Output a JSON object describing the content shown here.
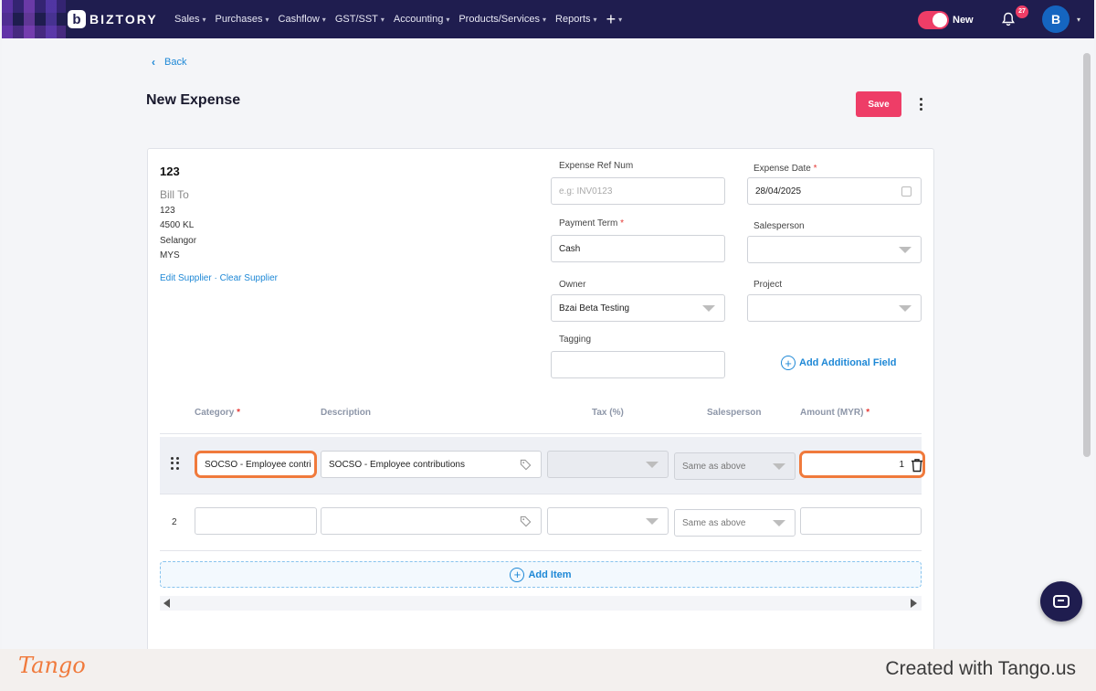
{
  "nav": {
    "brand": "BIZTORY",
    "menu": [
      "Sales",
      "Purchases",
      "Cashflow",
      "GST/SST",
      "Accounting",
      "Products/Services",
      "Reports"
    ],
    "toggle_label": "New",
    "notification_count": "27",
    "avatar_initial": "B"
  },
  "header": {
    "back_label": "Back",
    "page_title": "New Expense",
    "save_label": "Save"
  },
  "supplier": {
    "name": "123",
    "bill_to_label": "Bill To",
    "address": [
      "123",
      "4500 KL",
      "Selangor",
      "MYS"
    ],
    "edit_link": "Edit Supplier",
    "separator": "·",
    "clear_link": "Clear Supplier"
  },
  "fields": {
    "expense_ref": {
      "label": "Expense Ref Num",
      "placeholder": "e.g: INV0123",
      "value": ""
    },
    "expense_date": {
      "label": "Expense Date",
      "required": "*",
      "value": "28/04/2025"
    },
    "payment_term": {
      "label": "Payment Term",
      "required": "*",
      "value": "Cash"
    },
    "salesperson": {
      "label": "Salesperson",
      "value": ""
    },
    "owner": {
      "label": "Owner",
      "value": "Bzai Beta Testing"
    },
    "project": {
      "label": "Project",
      "value": ""
    },
    "tagging": {
      "label": "Tagging",
      "value": ""
    },
    "add_field_label": "Add Additional Field"
  },
  "table": {
    "headers": {
      "category": "Category",
      "description": "Description",
      "tax": "Tax (%)",
      "salesperson": "Salesperson",
      "amount": "Amount (MYR)",
      "required": "*"
    },
    "rows": [
      {
        "number": "",
        "category": "SOCSO - Employee contri",
        "description": "SOCSO - Employee contributions",
        "tax": "",
        "salesperson": "Same as above",
        "amount": "1"
      },
      {
        "number": "2",
        "category": "",
        "description": "",
        "tax": "",
        "salesperson": "Same as above",
        "amount": ""
      }
    ],
    "add_item_label": "Add Item"
  },
  "footer": {
    "brand": "Tango",
    "credit": "Created with Tango.us"
  },
  "colors": {
    "nav_bg": "#1f1d4f",
    "accent": "#ee3d67",
    "link": "#1e88d6",
    "highlight": "#f07a3c"
  }
}
